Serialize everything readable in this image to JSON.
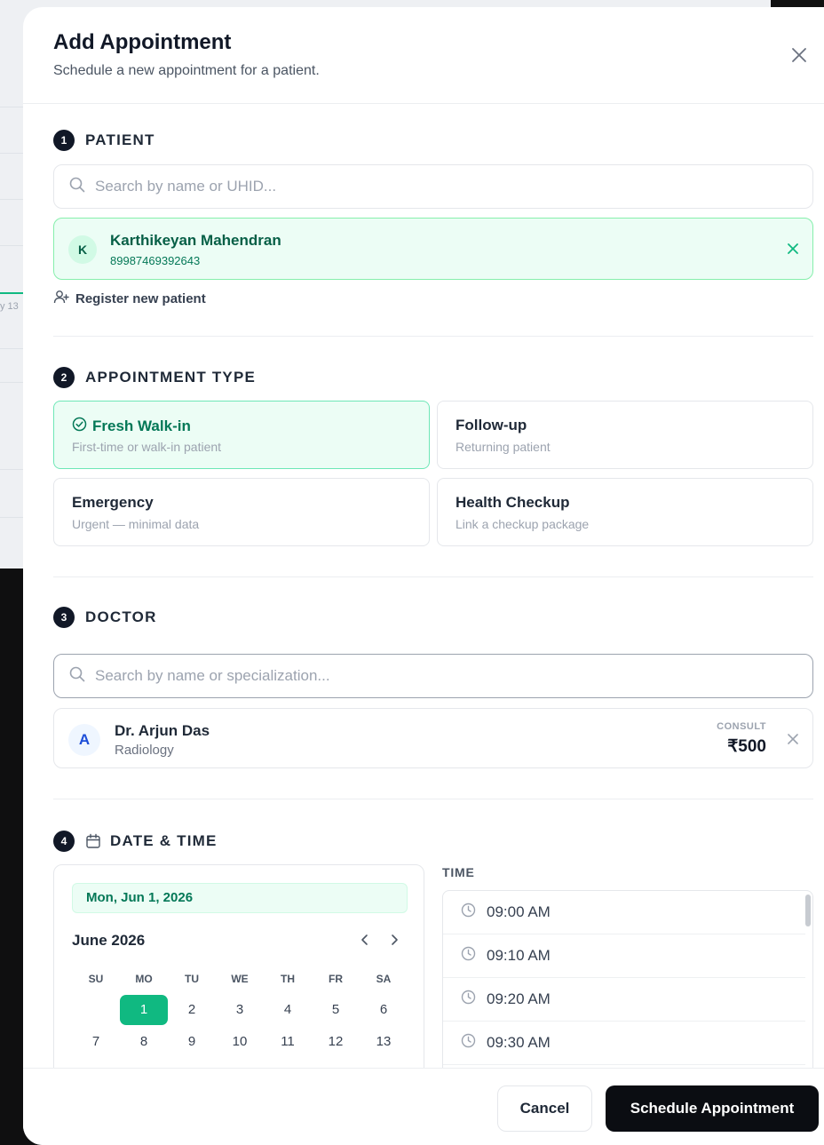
{
  "background": {
    "day_label": "y 13"
  },
  "modal": {
    "title": "Add Appointment",
    "subtitle": "Schedule a new appointment for a patient."
  },
  "patient": {
    "step": "1",
    "title": "PATIENT",
    "search_placeholder": "Search by name or UHID...",
    "selected": {
      "initial": "K",
      "name": "Karthikeyan Mahendran",
      "uhid": "89987469392643"
    },
    "register_label": "Register new patient"
  },
  "appointment_type": {
    "step": "2",
    "title": "APPOINTMENT TYPE",
    "options": [
      {
        "title": "Fresh Walk-in",
        "desc": "First-time or walk-in patient",
        "selected": true
      },
      {
        "title": "Follow-up",
        "desc": "Returning patient",
        "selected": false
      },
      {
        "title": "Emergency",
        "desc": "Urgent — minimal data",
        "selected": false
      },
      {
        "title": "Health Checkup",
        "desc": "Link a checkup package",
        "selected": false
      }
    ]
  },
  "doctor": {
    "step": "3",
    "title": "DOCTOR",
    "search_placeholder": "Search by name or specialization...",
    "selected": {
      "initial": "A",
      "name": "Dr. Arjun Das",
      "specialization": "Radiology",
      "consult_label": "CONSULT",
      "fee": "₹500"
    }
  },
  "datetime": {
    "step": "4",
    "title": "DATE & TIME",
    "selected_date": "Mon, Jun 1, 2026",
    "month": "June 2026",
    "weekdays": [
      "SU",
      "MO",
      "TU",
      "WE",
      "TH",
      "FR",
      "SA"
    ],
    "weeks": [
      [
        "",
        "1",
        "2",
        "3",
        "4",
        "5",
        "6"
      ],
      [
        "7",
        "8",
        "9",
        "10",
        "11",
        "12",
        "13"
      ]
    ],
    "selected_day": "1",
    "time_label": "TIME",
    "slots": [
      "09:00 AM",
      "09:10 AM",
      "09:20 AM",
      "09:30 AM"
    ]
  },
  "footer": {
    "cancel_label": "Cancel",
    "submit_label": "Schedule Appointment"
  },
  "colors": {
    "accent_green": "#10b981",
    "selected_bg": "#ecfdf5",
    "primary_dark": "#0b0d12"
  }
}
